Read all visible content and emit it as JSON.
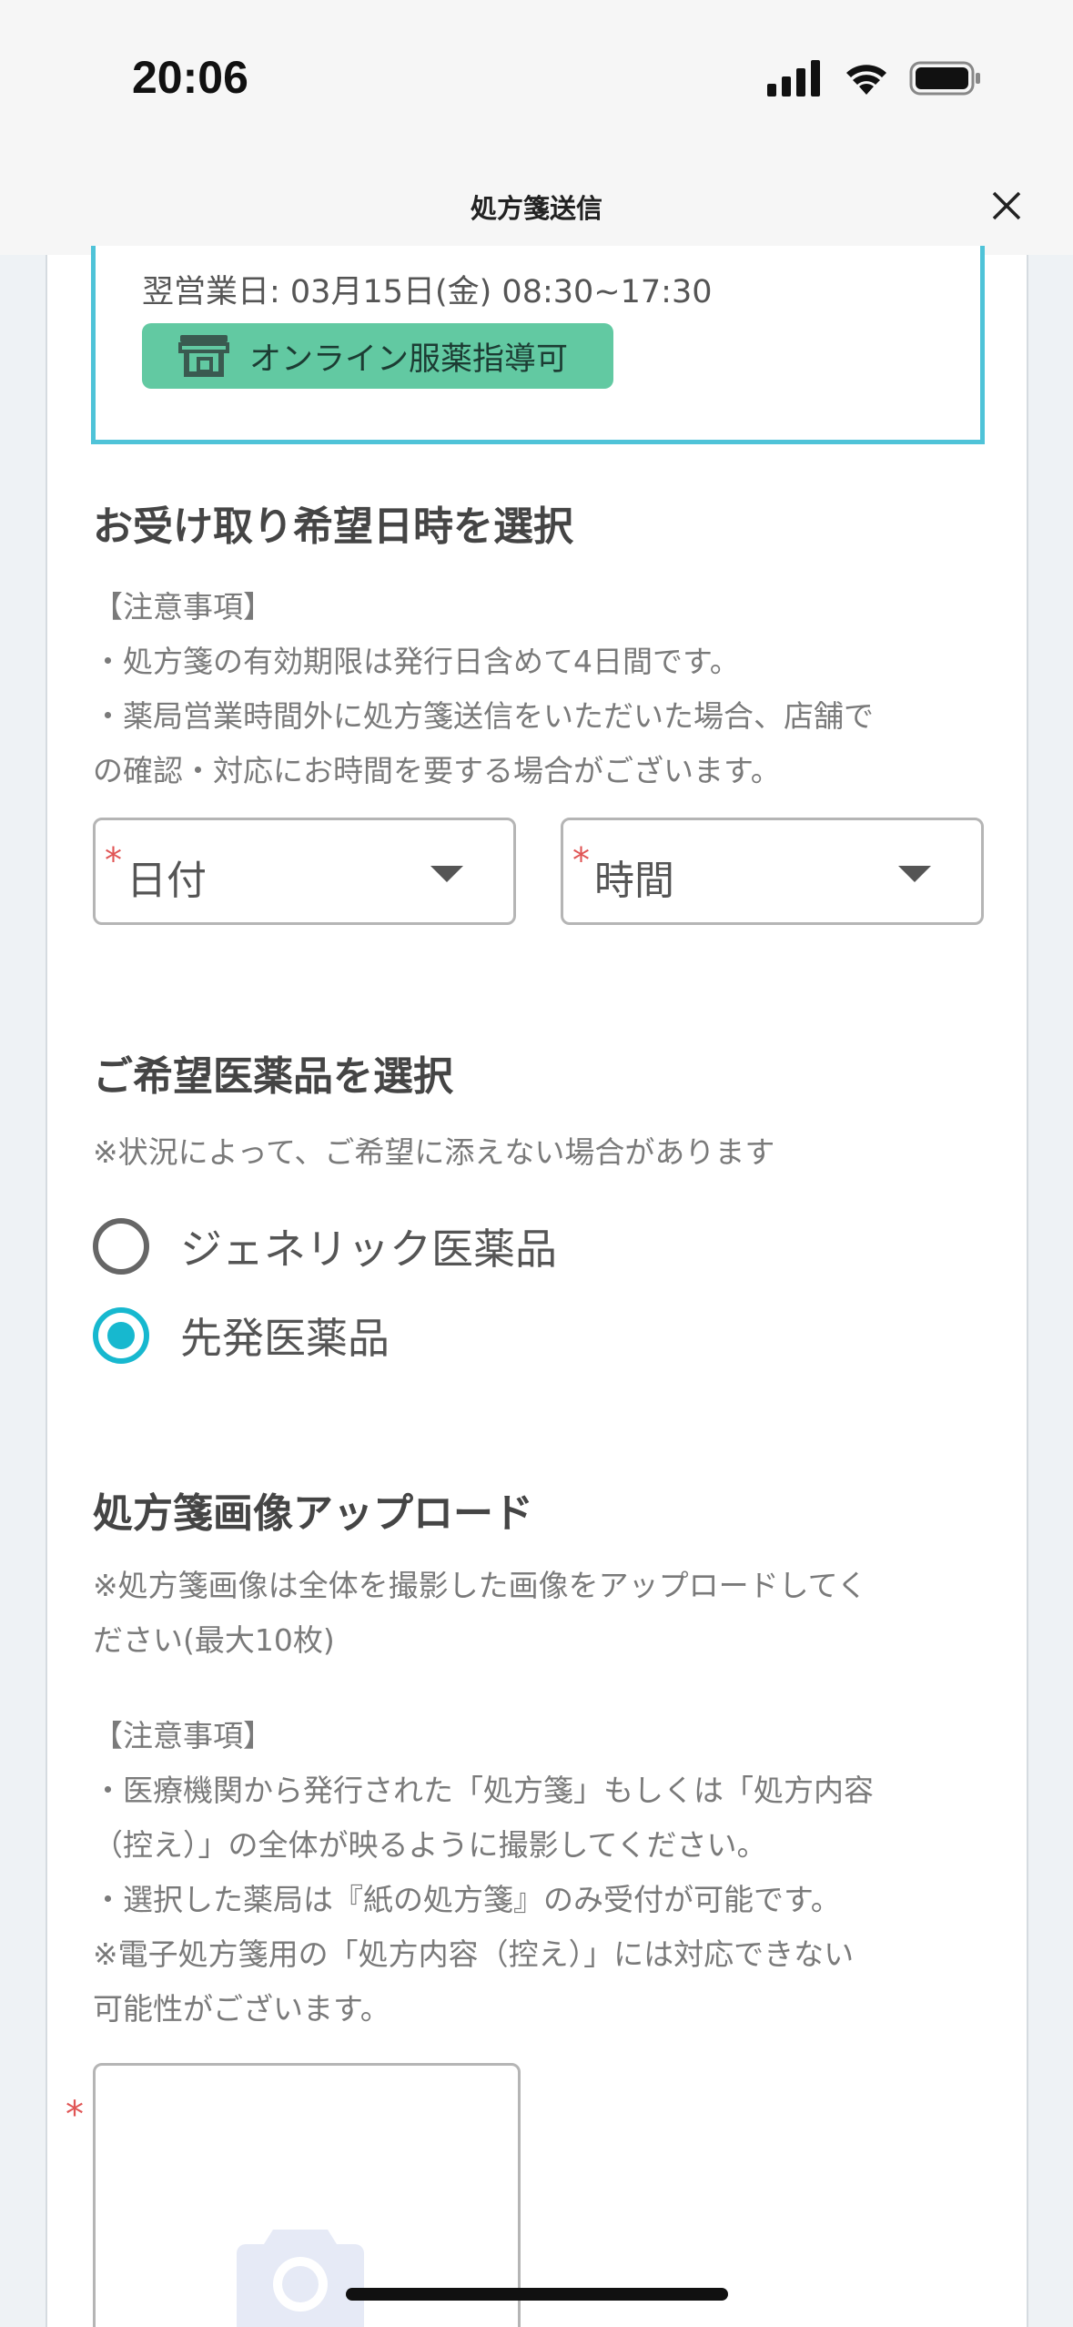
{
  "status_bar": {
    "time": "20:06",
    "icons": [
      "signal-icon",
      "wifi-icon",
      "battery-icon"
    ]
  },
  "header": {
    "title": "処方箋送信",
    "close_icon": "close-icon"
  },
  "pharmacy": {
    "next_business_day": "翌営業日: 03月15日(金) 08:30~17:30",
    "online_badge": "オンライン服薬指導可",
    "badge_icon": "store-icon",
    "badge_color": "#62c9a2",
    "border_color": "#4fc3d8"
  },
  "pickup": {
    "title": "お受け取り希望日時を選択",
    "notes": [
      "【注意事項】",
      "・処方箋の有効期限は発行日含めて4日間です。",
      "・薬局営業時間外に処方箋送信をいただいた場合、店舗で",
      "の確認・対応にお時間を要する場合がございます。"
    ],
    "date_select": {
      "required_mark": "*",
      "label": "日付"
    },
    "time_select": {
      "required_mark": "*",
      "label": "時間"
    }
  },
  "medicine": {
    "title": "ご希望医薬品を選択",
    "note": "※状況によって、ご希望に添えない場合があります",
    "options": [
      {
        "label": "ジェネリック医薬品",
        "checked": false
      },
      {
        "label": "先発医薬品",
        "checked": true
      }
    ],
    "accent_color": "#17b8cf"
  },
  "upload": {
    "title": "処方箋画像アップロード",
    "intro": [
      "※処方箋画像は全体を撮影した画像をアップロードしてく",
      "ださい(最大10枚)"
    ],
    "notes": [
      "【注意事項】",
      "・医療機関から発行された「処方箋」もしくは「処方内容",
      "（控え）」の全体が映るように撮影してください。",
      "・選択した薬局は『紙の処方箋』のみ受付が可能です。",
      "※電子処方箋用の「処方内容（控え）」には対応できない",
      "可能性がございます。"
    ],
    "required_mark": "*",
    "camera_icon": "camera-icon"
  }
}
